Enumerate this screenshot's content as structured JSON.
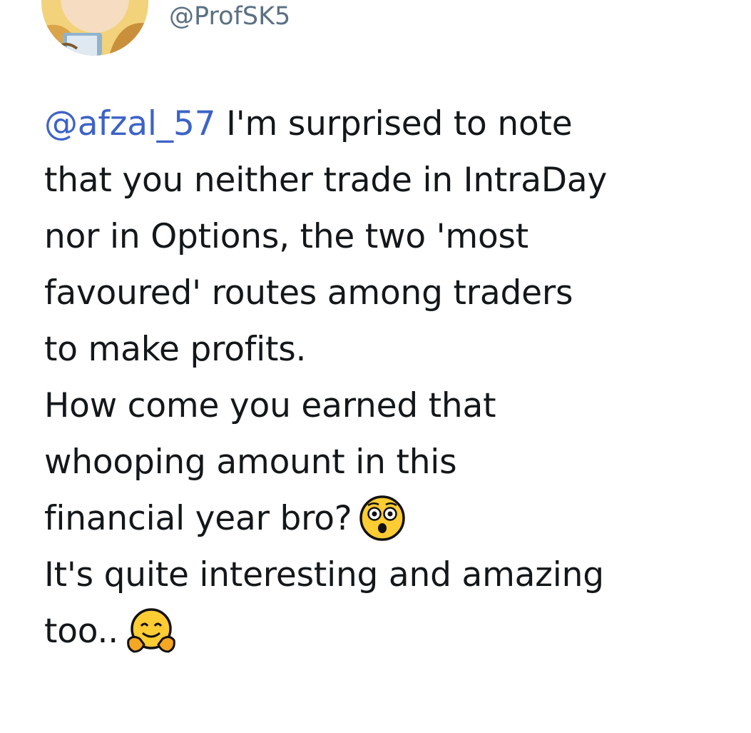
{
  "author": {
    "handle": "@ProfSK5",
    "avatar_icon": "profile-avatar-cartoon"
  },
  "tweet": {
    "mention": "@afzal_57",
    "line1_rest": " I'm surprised to note",
    "line2": "that you neither trade in IntraDay",
    "line3": "nor in Options, the two 'most",
    "line4": "favoured' routes among traders",
    "line5": "to make profits.",
    "line6": "How come you earned that",
    "line7": "whooping amount in this",
    "line8": "financial year bro?",
    "line9": "It's quite interesting and amazing",
    "line10": "too..",
    "emoji_1": "flushed-face-emoji",
    "emoji_2": "hugging-face-emoji"
  },
  "colors": {
    "text": "#14171a",
    "handle": "#5b7083",
    "mention": "#3d63c7",
    "background": "#ffffff"
  }
}
